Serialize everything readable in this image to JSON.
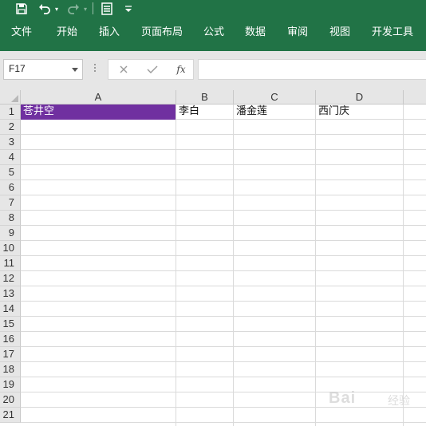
{
  "quick_access": {
    "save_icon": "save-icon",
    "undo_icon": "undo-icon",
    "redo_icon": "redo-icon",
    "form_icon": "form-icon",
    "customize_icon": "customize-qat-icon"
  },
  "ribbon": {
    "tabs": [
      "文件",
      "开始",
      "插入",
      "页面布局",
      "公式",
      "数据",
      "审阅",
      "视图",
      "开发工具"
    ]
  },
  "formula_bar": {
    "name_box": "F17",
    "fx_label": "fx",
    "formula": ""
  },
  "sheet": {
    "columns": [
      "A",
      "B",
      "C",
      "D"
    ],
    "rows": [
      "1",
      "2",
      "3",
      "4",
      "5",
      "6",
      "7",
      "8",
      "9",
      "10",
      "11",
      "12",
      "13",
      "14",
      "15",
      "16",
      "17",
      "18",
      "19",
      "20",
      "21"
    ],
    "cells": {
      "A1": "苍井空",
      "B1": "李白",
      "C1": "潘金莲",
      "D1": "西门庆"
    },
    "highlight_color": "#7030a0"
  },
  "colors": {
    "ribbon_green": "#217346",
    "header_gray": "#e6e6e6"
  },
  "watermark": {
    "text": "Bai",
    "suffix": "经验"
  }
}
